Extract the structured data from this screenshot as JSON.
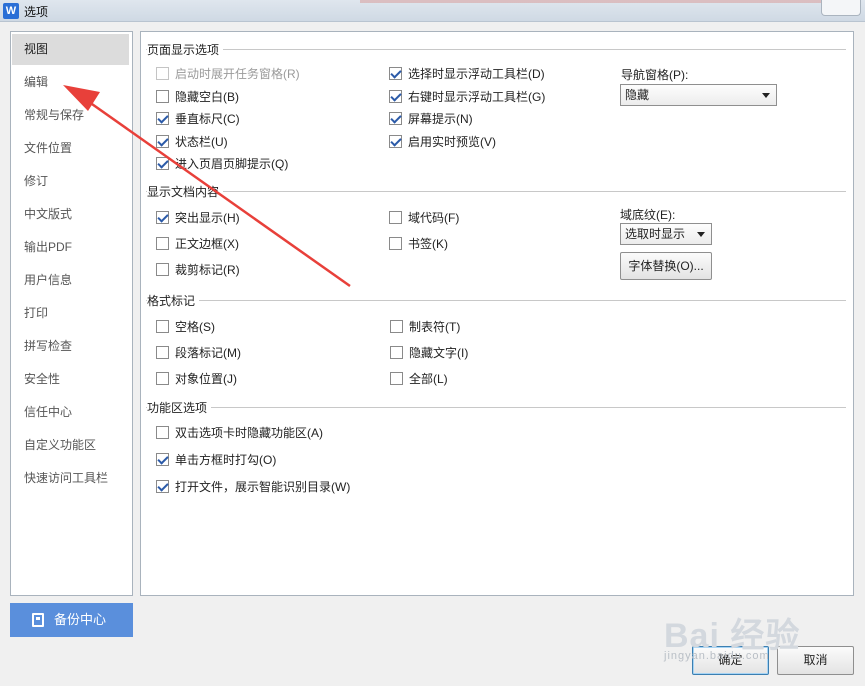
{
  "window": {
    "title": "选项",
    "app_icon_letter": "W"
  },
  "nav": {
    "items": [
      "视图",
      "编辑",
      "常规与保存",
      "文件位置",
      "修订",
      "中文版式",
      "输出PDF",
      "用户信息",
      "打印",
      "拼写检查",
      "安全性",
      "信任中心",
      "自定义功能区",
      "快速访问工具栏"
    ],
    "selected_index": 0,
    "backup_label": "备份中心"
  },
  "sections": {
    "page_display": {
      "title": "页面显示选项",
      "col1": [
        {
          "label": "启动时展开任务窗格(R)",
          "checked": false,
          "disabled": true
        },
        {
          "label": "隐藏空白(B)",
          "checked": false
        },
        {
          "label": "垂直标尺(C)",
          "checked": true
        },
        {
          "label": "状态栏(U)",
          "checked": true
        },
        {
          "label": "进入页眉页脚提示(Q)",
          "checked": true
        }
      ],
      "col2": [
        {
          "label": "选择时显示浮动工具栏(D)",
          "checked": true
        },
        {
          "label": "右键时显示浮动工具栏(G)",
          "checked": true
        },
        {
          "label": "屏幕提示(N)",
          "checked": true
        },
        {
          "label": "启用实时预览(V)",
          "checked": true
        }
      ],
      "nav_pane_label": "导航窗格(P):",
      "nav_pane_value": "隐藏"
    },
    "doc_content": {
      "title": "显示文档内容",
      "col1": [
        {
          "label": "突出显示(H)",
          "checked": true
        },
        {
          "label": "正文边框(X)",
          "checked": false
        },
        {
          "label": "裁剪标记(R)",
          "checked": false
        }
      ],
      "col2": [
        {
          "label": "域代码(F)",
          "checked": false
        },
        {
          "label": "书签(K)",
          "checked": false
        }
      ],
      "field_shading_label": "域底纹(E):",
      "field_shading_value": "选取时显示",
      "font_replace_label": "字体替换(O)..."
    },
    "format_marks": {
      "title": "格式标记",
      "col1": [
        {
          "label": "空格(S)",
          "checked": false
        },
        {
          "label": "段落标记(M)",
          "checked": false
        },
        {
          "label": "对象位置(J)",
          "checked": false
        }
      ],
      "col2": [
        {
          "label": "制表符(T)",
          "checked": false
        },
        {
          "label": "隐藏文字(I)",
          "checked": false
        },
        {
          "label": "全部(L)",
          "checked": false
        }
      ]
    },
    "ribbon": {
      "title": "功能区选项",
      "items": [
        {
          "label": "双击选项卡时隐藏功能区(A)",
          "checked": false
        },
        {
          "label": "单击方框时打勾(O)",
          "checked": true
        },
        {
          "label": "打开文件，展示智能识别目录(W)",
          "checked": true
        }
      ]
    }
  },
  "footer": {
    "ok_label": "确定",
    "cancel_label": "取消"
  },
  "watermark": {
    "text": "Bai 经验",
    "url": "jingyan.baidu.com"
  },
  "annotation_arrow_color": "#e8403a"
}
